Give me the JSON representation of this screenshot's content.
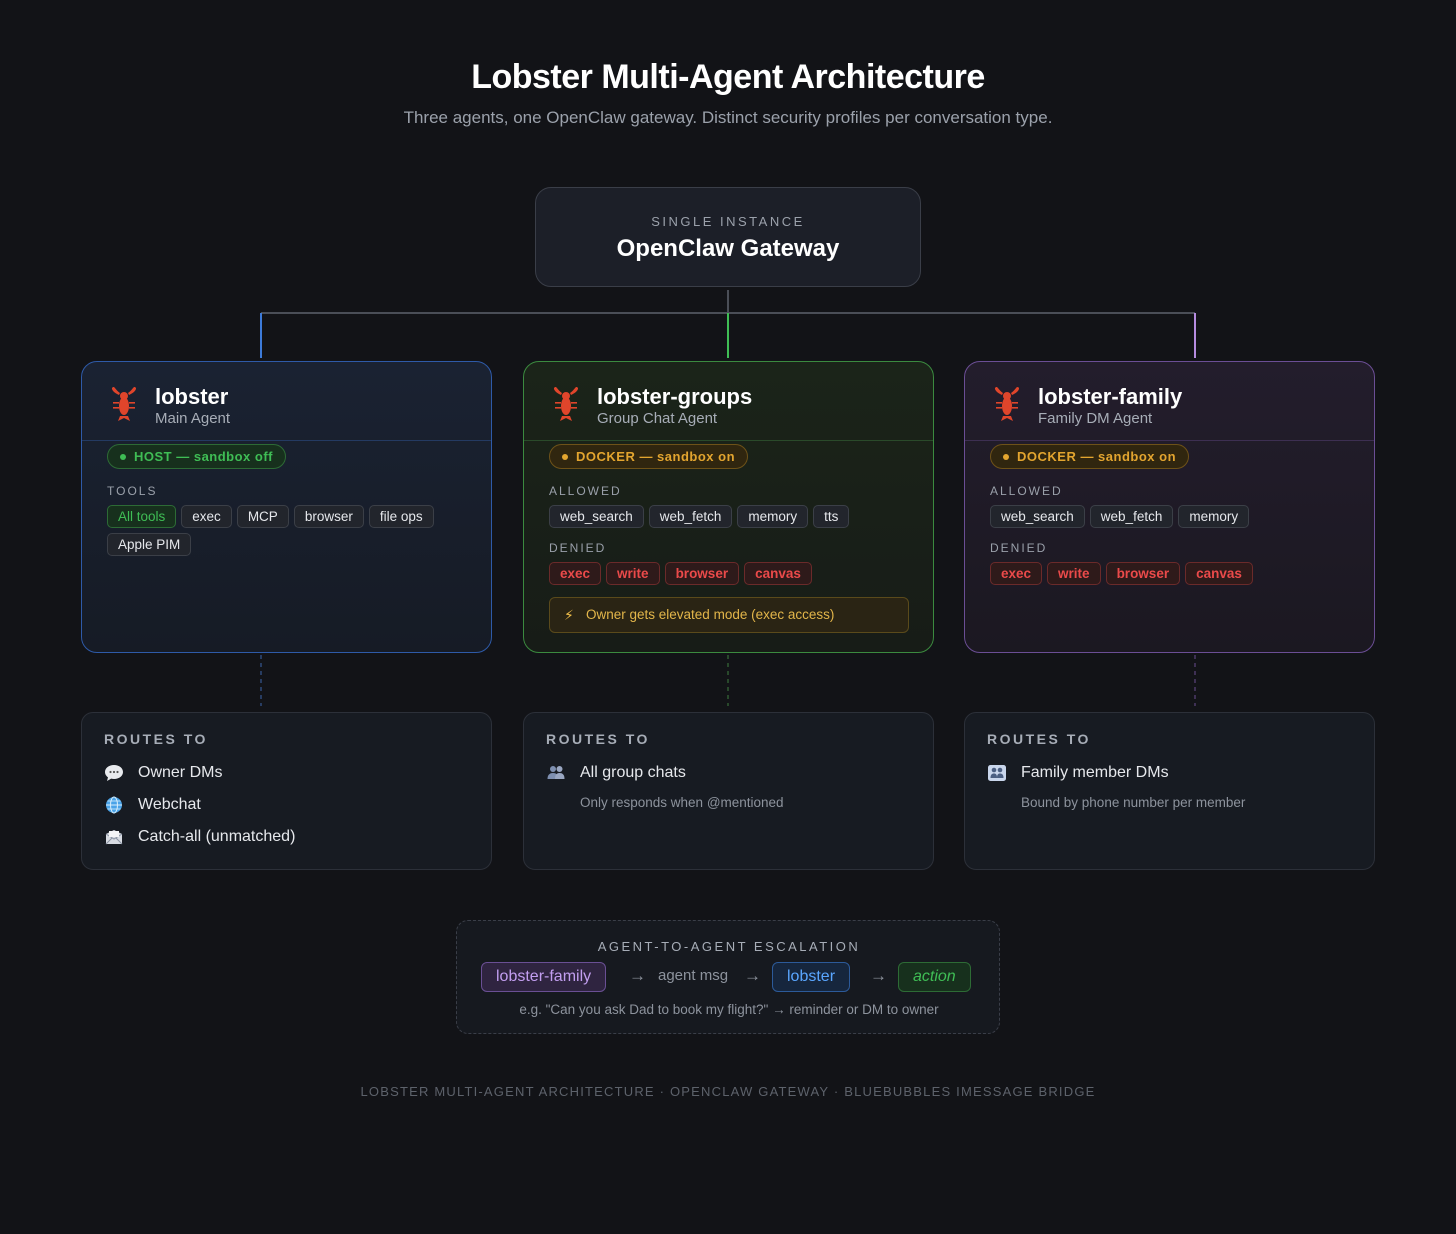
{
  "header": {
    "title": "Lobster Multi-Agent Architecture",
    "subtitle": "Three agents, one OpenClaw gateway. Distinct security profiles per conversation type."
  },
  "gateway": {
    "kicker": "SINGLE INSTANCE",
    "name": "OpenClaw Gateway"
  },
  "colors": {
    "blue": "#2e5aa8",
    "green": "#3b8a3f",
    "purple": "#6b4e95",
    "connector_blue": "#3d7bd9",
    "connector_green": "#3fbd55",
    "connector_purple": "#b58be0"
  },
  "agents": [
    {
      "icon": "lobster-icon",
      "name": "lobster",
      "role": "Main Agent",
      "mode": "HOST — sandbox off",
      "tools_label": "TOOLS",
      "tools": [
        "All tools",
        "exec",
        "MCP",
        "browser",
        "file ops",
        "Apple PIM"
      ]
    },
    {
      "icon": "lobster-icon",
      "name": "lobster-groups",
      "role": "Group Chat Agent",
      "mode": "DOCKER — sandbox on",
      "allowed_label": "ALLOWED",
      "allowed": [
        "web_search",
        "web_fetch",
        "memory",
        "tts"
      ],
      "denied_label": "DENIED",
      "denied": [
        "exec",
        "write",
        "browser",
        "canvas"
      ],
      "note": "Owner gets elevated mode (exec access)"
    },
    {
      "icon": "lobster-icon",
      "name": "lobster-family",
      "role": "Family DM Agent",
      "mode": "DOCKER — sandbox on",
      "allowed_label": "ALLOWED",
      "allowed": [
        "web_search",
        "web_fetch",
        "memory"
      ],
      "denied_label": "DENIED",
      "denied": [
        "exec",
        "write",
        "browser",
        "canvas"
      ]
    }
  ],
  "routes": [
    {
      "label": "ROUTES TO",
      "items": [
        {
          "icon": "speech-bubble-icon",
          "text": "Owner DMs"
        },
        {
          "icon": "globe-icon",
          "text": "Webchat"
        },
        {
          "icon": "envelope-icon",
          "text": "Catch-all (unmatched)"
        }
      ]
    },
    {
      "label": "ROUTES TO",
      "items": [
        {
          "icon": "people-icon",
          "text": "All group chats"
        }
      ],
      "sub": "Only responds when @mentioned"
    },
    {
      "label": "ROUTES TO",
      "items": [
        {
          "icon": "family-icon",
          "text": "Family member DMs"
        }
      ],
      "sub": "Bound by phone number per member"
    }
  ],
  "escalation": {
    "title": "AGENT-TO-AGENT ESCALATION",
    "from": "lobster-family",
    "via": "agent msg",
    "to": "lobster",
    "result": "action",
    "example": "e.g. \"Can you ask Dad to book my flight?\" → reminder or DM to owner"
  },
  "footer": "LOBSTER MULTI-AGENT ARCHITECTURE · OPENCLAW GATEWAY · BLUEBUBBLES IMESSAGE BRIDGE"
}
